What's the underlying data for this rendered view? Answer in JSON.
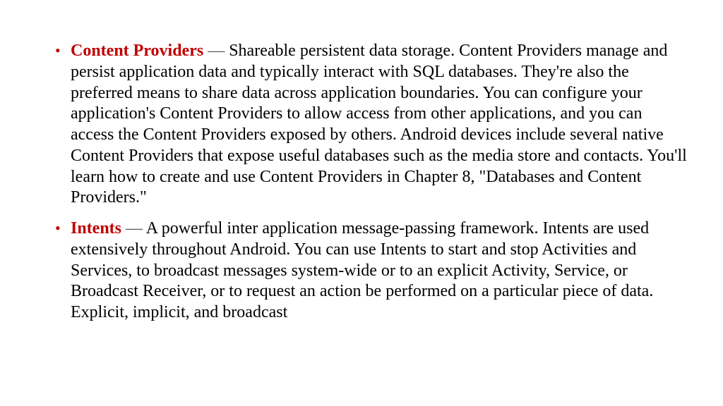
{
  "items": [
    {
      "term": "Content Providers",
      "dash": " — ",
      "body": "Shareable persistent data storage. Content Providers manage and persist application data and typically interact with SQL databases. They're also the preferred means to share data across application boundaries. You can configure your application's Content Providers to allow access from other applications, and you can access the Content Providers exposed by others. Android devices include several native Content Providers that expose useful databases such as the media store and contacts. You'll learn how to create and use Content Providers in Chapter 8, \"Databases and Content Providers.\""
    },
    {
      "term": "Intents",
      "dash": " — ",
      "body": "A powerful inter application message-passing framework. Intents are used extensively throughout Android. You can use Intents to start and stop Activities and Services, to broadcast messages system-wide or to an explicit Activity, Service, or Broadcast Receiver, or to request an action be performed on a particular piece of data. Explicit, implicit, and broadcast"
    }
  ]
}
